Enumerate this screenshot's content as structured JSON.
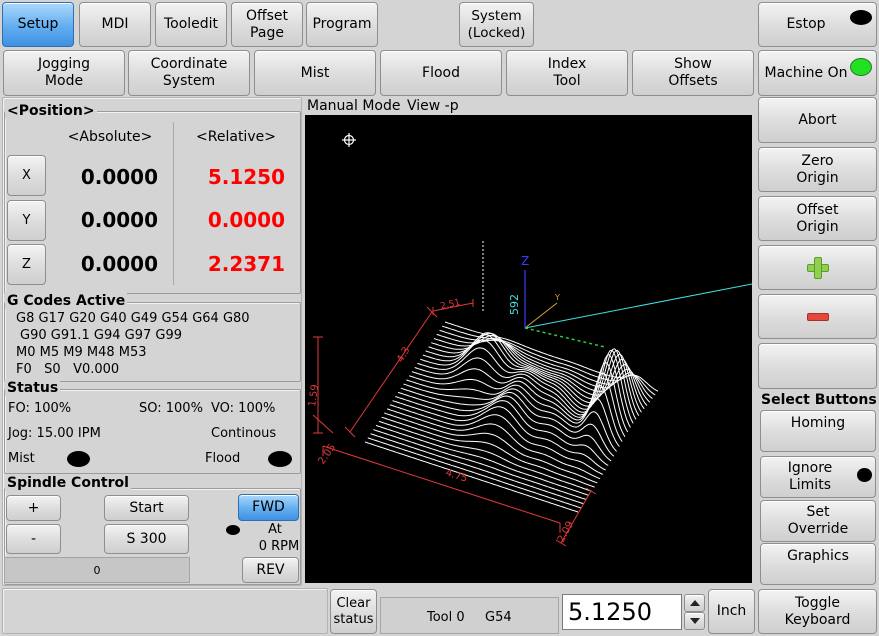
{
  "colors": {
    "active_button": "#4f9deb",
    "relative_value": "#ff0000",
    "led_off": "#000000",
    "machine_on_led": "#22e022",
    "plot_background": "#000000",
    "toolpath": "#ffffff",
    "dimension": "#e03a3a",
    "axis_z": "#3a3aff",
    "axis_x": "#2ecc40",
    "axis_y": "#e0a030",
    "cyan_path": "#3fe0e0",
    "plus_icon": "#8fd14f",
    "minus_icon": "#e4473c"
  },
  "icons": {
    "estop_led": "led-icon",
    "machine_on_led": "led-icon",
    "plus": "plus-icon",
    "minus": "minus-icon",
    "origin": "crosshair-icon",
    "spin_up": "arrow-up-icon",
    "spin_down": "arrow-down-icon"
  },
  "top_row": {
    "setup": "Setup",
    "mdi": "MDI",
    "tooledit": "Tooledit",
    "offset_page": "Offset\nPage",
    "program": "Program",
    "system": "System\n(Locked)",
    "estop": "Estop"
  },
  "second_row": {
    "jogging_mode": "Jogging\nMode",
    "coordinate_system": "Coordinate\nSystem",
    "mist": "Mist",
    "flood": "Flood",
    "index_tool": "Index\nTool",
    "show_offsets": "Show\nOffsets",
    "machine_on": "Machine On"
  },
  "position": {
    "title": "<Position>",
    "absolute_header": "<Absolute>",
    "relative_header": "<Relative>",
    "axes": [
      {
        "label": "X",
        "absolute": "0.0000",
        "relative": "5.1250"
      },
      {
        "label": "Y",
        "absolute": "0.0000",
        "relative": "0.0000"
      },
      {
        "label": "Z",
        "absolute": "0.0000",
        "relative": "2.2371"
      }
    ]
  },
  "gcodes": {
    "title": "G Codes Active",
    "lines": [
      "G8 G17 G20 G40 G49 G54 G64 G80",
      "G90 G91.1 G94 G97 G99",
      "M0 M5 M9 M48 M53",
      "F0   S0   V0.000"
    ]
  },
  "status": {
    "title": "Status",
    "feed_override": "FO: 100%",
    "spindle_override": "SO: 100%",
    "velocity_override": "VO: 100%",
    "jog": "Jog: 15.00 IPM",
    "jog_mode": "Continous",
    "mist": "Mist",
    "flood": "Flood",
    "mist_on": false,
    "flood_on": false
  },
  "spindle": {
    "title": "Spindle Control",
    "plus": "+",
    "minus": "-",
    "start": "Start",
    "speed": "S 300",
    "fwd": "FWD",
    "rev": "REV",
    "at_speed": "At",
    "rpm": "0 RPM",
    "load": "0",
    "load_fraction": 0
  },
  "preview": {
    "mode": "Manual Mode",
    "view": "View -p",
    "labels": {
      "dim_top": "2.51",
      "dim_left": "4.3",
      "dim_height": "1.59",
      "dim_corner": "2.05",
      "dim_front": "4.75",
      "dim_right": "2.09",
      "axis_z": "Z",
      "axis_y": "Y",
      "axis_value": "592"
    }
  },
  "right_panel": {
    "abort": "Abort",
    "zero_origin": "Zero\nOrigin",
    "offset_origin": "Offset\nOrigin",
    "select_buttons": "Select Buttons",
    "homing": "Homing",
    "ignore_limits": "Ignore\nLimits",
    "set_override": "Set\nOverride",
    "graphics": "Graphics"
  },
  "bottom_bar": {
    "clear_status": "Clear\nstatus",
    "tool": "Tool 0",
    "work_offset": "G54",
    "entry_value": "5.1250",
    "units": "Inch",
    "toggle_keyboard": "Toggle\nKeyboard"
  }
}
